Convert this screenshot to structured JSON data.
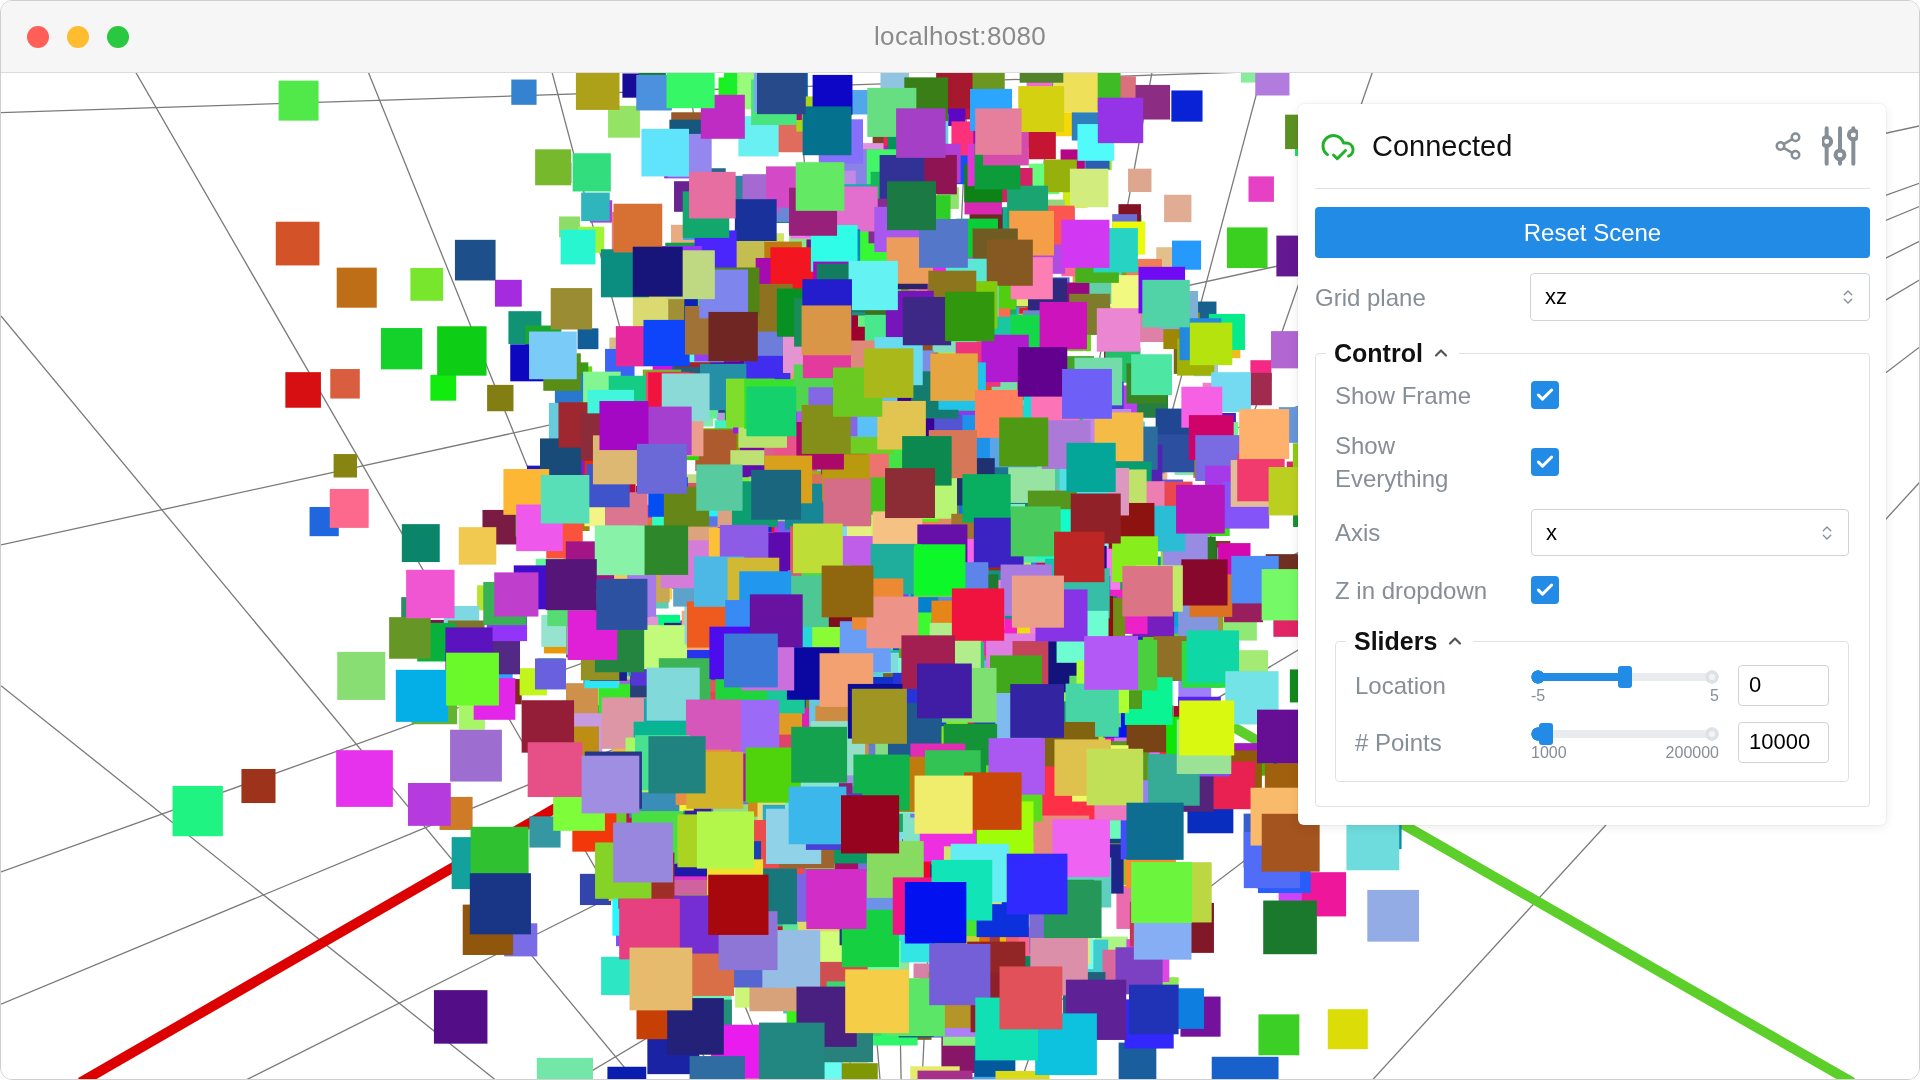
{
  "window": {
    "title": "localhost:8080"
  },
  "panel": {
    "status": "Connected",
    "reset_button": "Reset Scene",
    "grid_plane": {
      "label": "Grid plane",
      "value": "xz"
    },
    "control": {
      "title": "Control",
      "expanded": true,
      "items": [
        {
          "kind": "checkbox",
          "label": "Show Frame",
          "checked": true
        },
        {
          "kind": "checkbox",
          "label": "Show Everything",
          "checked": true
        },
        {
          "kind": "select",
          "label": "Axis",
          "value": "x"
        },
        {
          "kind": "checkbox",
          "label": "Z in dropdown",
          "checked": true
        }
      ],
      "sliders": {
        "title": "Sliders",
        "expanded": true,
        "items": [
          {
            "label": "Location",
            "min": "-5",
            "max": "5",
            "value": "0",
            "level": 0.5
          },
          {
            "label": "# Points",
            "min": "1000",
            "max": "200000",
            "value": "10000",
            "level": 0.045
          }
        ]
      }
    }
  }
}
